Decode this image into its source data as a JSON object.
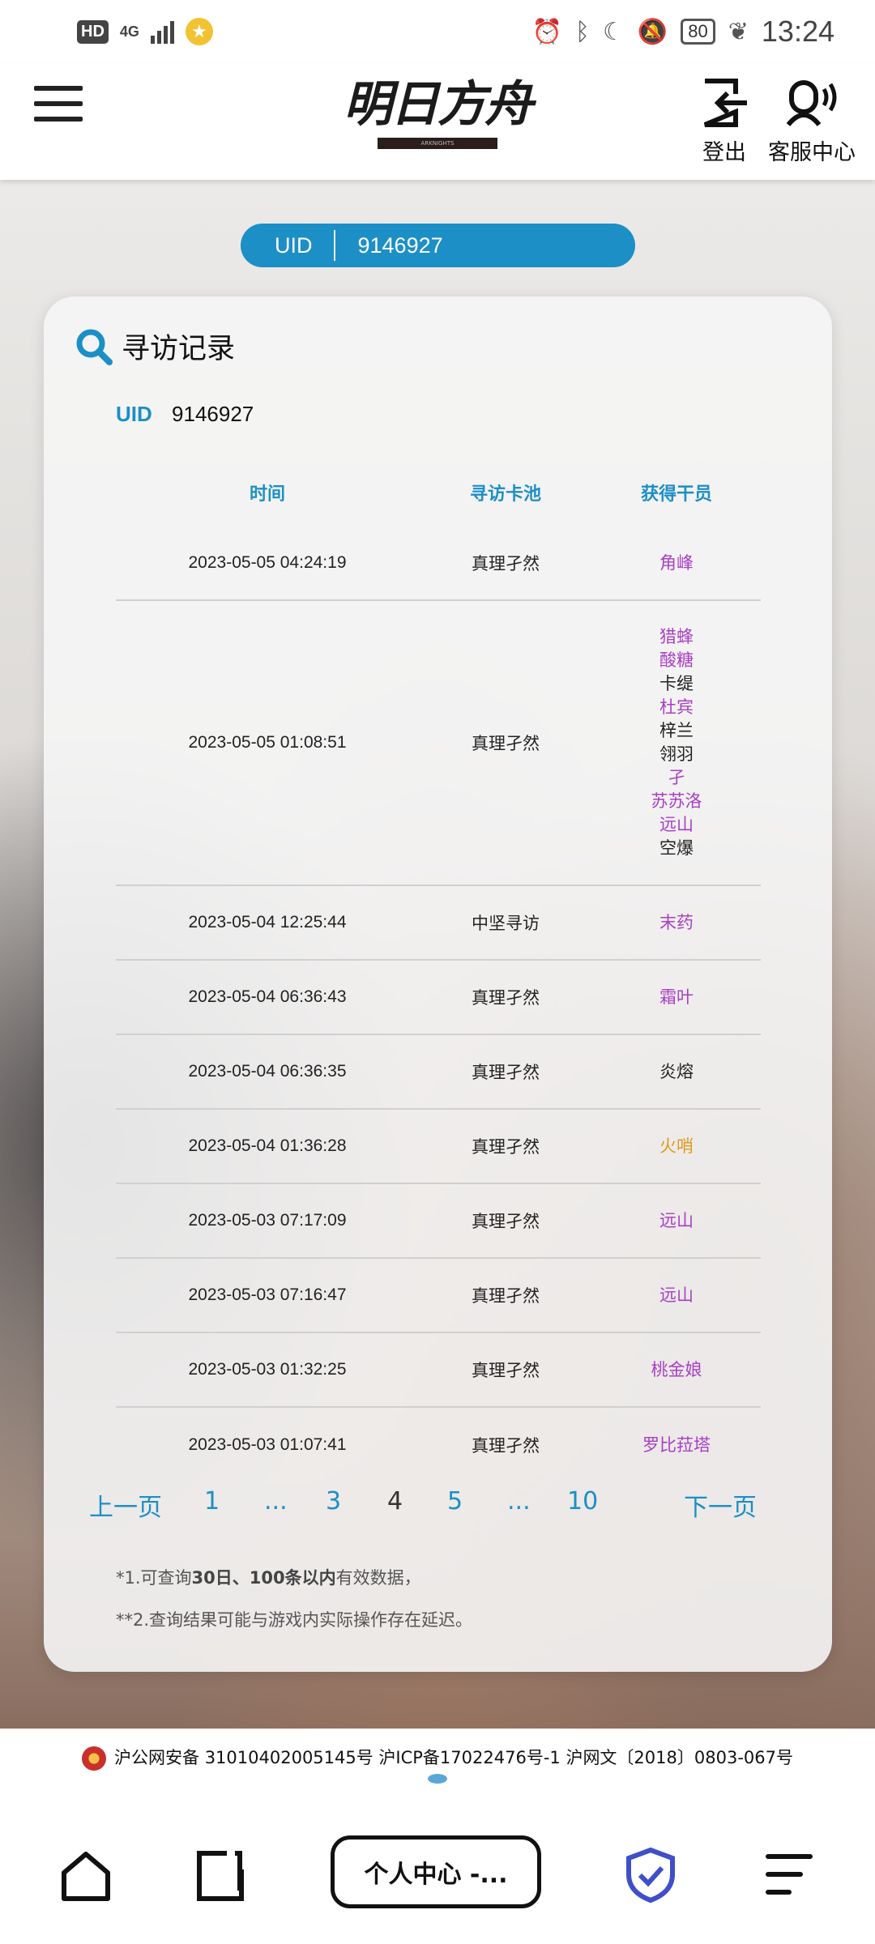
{
  "status_bar": {
    "hd": "HD",
    "network": "4G",
    "battery": "80",
    "time": "13:24"
  },
  "header": {
    "logo_text": "明日方舟",
    "logo_sub": "ARKNIGHTS",
    "logout_label": "登出",
    "service_label": "客服中心"
  },
  "uid_pill": {
    "label": "UID",
    "value": "9146927"
  },
  "card": {
    "title": "寻访记录",
    "uid_label": "UID",
    "uid_value": "9146927",
    "columns": {
      "time": "时间",
      "pool": "寻访卡池",
      "operator": "获得干员"
    },
    "rows": [
      {
        "time": "2023-05-05 04:24:19",
        "pool": "真理孑然",
        "operators": [
          {
            "name": "角峰",
            "rarity_color": "purple"
          }
        ]
      },
      {
        "time": "2023-05-05 01:08:51",
        "pool": "真理孑然",
        "operators": [
          {
            "name": "猎蜂",
            "rarity_color": "purple"
          },
          {
            "name": "酸糖",
            "rarity_color": "purple"
          },
          {
            "name": "卡缇",
            "rarity_color": "black"
          },
          {
            "name": "杜宾",
            "rarity_color": "purple"
          },
          {
            "name": "梓兰",
            "rarity_color": "black"
          },
          {
            "name": "翎羽",
            "rarity_color": "black"
          },
          {
            "name": "孑",
            "rarity_color": "purple"
          },
          {
            "name": "苏苏洛",
            "rarity_color": "purple"
          },
          {
            "name": "远山",
            "rarity_color": "purple"
          },
          {
            "name": "空爆",
            "rarity_color": "black"
          }
        ]
      },
      {
        "time": "2023-05-04 12:25:44",
        "pool": "中坚寻访",
        "operators": [
          {
            "name": "末药",
            "rarity_color": "purple"
          }
        ]
      },
      {
        "time": "2023-05-04 06:36:43",
        "pool": "真理孑然",
        "operators": [
          {
            "name": "霜叶",
            "rarity_color": "purple"
          }
        ]
      },
      {
        "time": "2023-05-04 06:36:35",
        "pool": "真理孑然",
        "operators": [
          {
            "name": "炎熔",
            "rarity_color": "black"
          }
        ]
      },
      {
        "time": "2023-05-04 01:36:28",
        "pool": "真理孑然",
        "operators": [
          {
            "name": "火哨",
            "rarity_color": "orange"
          }
        ]
      },
      {
        "time": "2023-05-03 07:17:09",
        "pool": "真理孑然",
        "operators": [
          {
            "name": "远山",
            "rarity_color": "purple"
          }
        ]
      },
      {
        "time": "2023-05-03 07:16:47",
        "pool": "真理孑然",
        "operators": [
          {
            "name": "远山",
            "rarity_color": "purple"
          }
        ]
      },
      {
        "time": "2023-05-03 01:32:25",
        "pool": "真理孑然",
        "operators": [
          {
            "name": "桃金娘",
            "rarity_color": "purple"
          }
        ]
      },
      {
        "time": "2023-05-03 01:07:41",
        "pool": "真理孑然",
        "operators": [
          {
            "name": "罗比菈塔",
            "rarity_color": "purple"
          }
        ]
      }
    ],
    "pager": {
      "prev": "上一页",
      "p1": "1",
      "ellipsis1": "...",
      "p3": "3",
      "current": "4",
      "p5": "5",
      "ellipsis2": "...",
      "p10": "10",
      "next": "下一页"
    },
    "notes": {
      "n1_prefix": "*1.可查询",
      "n1_bold": "30日、100条以内",
      "n1_suffix": "有效数据，",
      "n2": "**2.查询结果可能与游戏内实际操作存在延迟。"
    }
  },
  "license": "沪公网安备 31010402005145号  沪ICP备17022476号-1  沪网文〔2018〕0803-067号",
  "bottom_bar": {
    "center_label": "个人中心 -..."
  },
  "colors": {
    "accent": "#1c8fc6",
    "purple": "#a83fc4",
    "orange": "#e09a1c",
    "shield": "#3f4fc9"
  }
}
